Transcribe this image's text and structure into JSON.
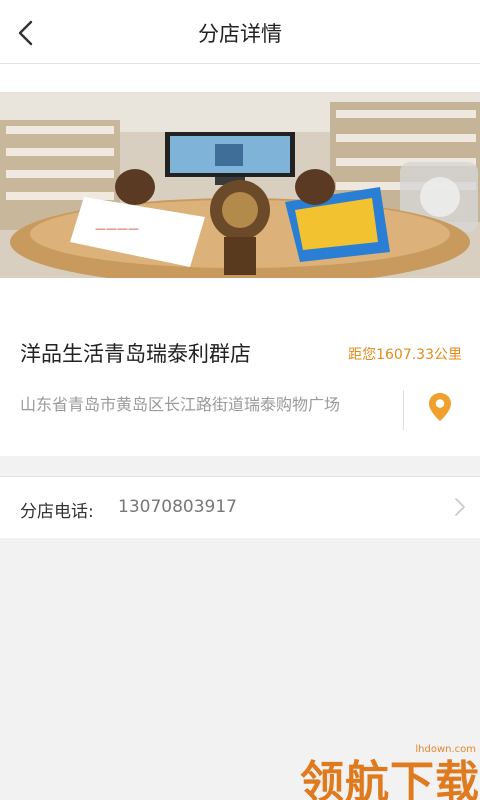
{
  "header": {
    "title": "分店详情",
    "back_icon": "back-arrow-icon"
  },
  "store": {
    "name": "洋品生活青岛瑞泰利群店",
    "distance": "距您1607.33公里",
    "address": "山东省青岛市黄岛区长江路街道瑞泰购物广场",
    "location_icon": "location-pin-icon",
    "photo_description_hidden": ""
  },
  "phone": {
    "label": "分店电话:",
    "number": "13070803917",
    "chevron_icon": "chevron-right-icon"
  },
  "watermark": {
    "text": "领航下载",
    "url": "lhdown.com"
  },
  "colors": {
    "accent": "#e58a1a",
    "text_primary": "#222222",
    "text_secondary": "#9a9a9a",
    "background": "#f2f2f2"
  }
}
